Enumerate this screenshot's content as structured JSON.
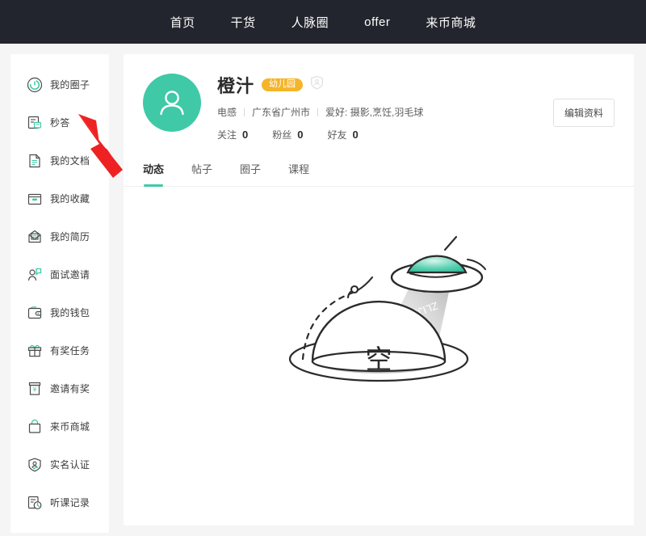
{
  "topnav": {
    "items": [
      {
        "label": "首页",
        "name": "nav-home"
      },
      {
        "label": "干货",
        "name": "nav-resources"
      },
      {
        "label": "人脉圈",
        "name": "nav-network"
      },
      {
        "label": "offer",
        "name": "nav-offer"
      },
      {
        "label": "来币商城",
        "name": "nav-shop"
      }
    ]
  },
  "sidebar": {
    "items": [
      {
        "label": "我的圈子",
        "icon": "circle-target-icon"
      },
      {
        "label": "秒答",
        "icon": "quick-answer-icon"
      },
      {
        "label": "我的文档",
        "icon": "document-icon"
      },
      {
        "label": "我的收藏",
        "icon": "folder-star-icon"
      },
      {
        "label": "我的简历",
        "icon": "resume-envelope-icon"
      },
      {
        "label": "面试邀请",
        "icon": "interview-invite-icon"
      },
      {
        "label": "我的钱包",
        "icon": "wallet-icon"
      },
      {
        "label": "有奖任务",
        "icon": "gift-icon"
      },
      {
        "label": "邀请有奖",
        "icon": "invite-reward-icon"
      },
      {
        "label": "来币商城",
        "icon": "shopping-bag-icon"
      },
      {
        "label": "实名认证",
        "icon": "shield-person-icon"
      },
      {
        "label": "听课记录",
        "icon": "course-history-icon"
      }
    ]
  },
  "profile": {
    "avatar_icon": "user-avatar-icon",
    "username": "橙汁",
    "level_badge": "幼儿园",
    "verify_icon": "verified-shield-icon",
    "industry": "电感",
    "location": "广东省广州市",
    "hobby": "爱好: 摄影,烹饪,羽毛球",
    "stats": [
      {
        "label": "关注",
        "value": "0"
      },
      {
        "label": "粉丝",
        "value": "0"
      },
      {
        "label": "好友",
        "value": "0"
      }
    ],
    "edit_button": "编辑资料"
  },
  "tabs": [
    {
      "label": "动态",
      "active": true
    },
    {
      "label": "帖子",
      "active": false
    },
    {
      "label": "圈子",
      "active": false
    },
    {
      "label": "课程",
      "active": false
    }
  ],
  "empty_state": {
    "planet_text": "空",
    "beam_text": "ZLIJL",
    "illustration": "empty-planet-ufo-illustration"
  },
  "annotation": {
    "arrow": "red-pointer-arrow",
    "color": "#ee2222"
  },
  "colors": {
    "accent_green": "#3fc9a7",
    "badge_orange": "#f5b52a",
    "topnav_bg": "#23252e",
    "page_bg": "#f5f5f5",
    "card_bg": "#ffffff"
  }
}
